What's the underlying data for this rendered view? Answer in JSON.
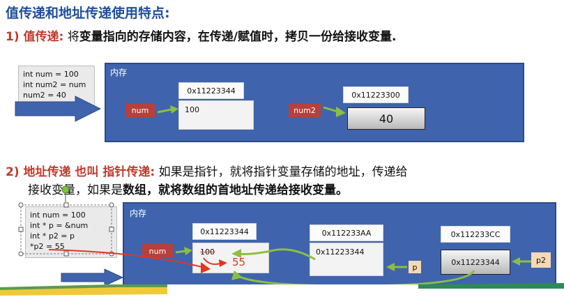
{
  "heading": "值传递和地址传递使用特点:",
  "section1": {
    "lead": "1) 值传递",
    "colon": ":",
    "text_a": "将",
    "text_b": "变量指向的存储内容，在传递/赋值时，拷贝一份给接收变量."
  },
  "section2": {
    "lead": "2) 地址传递 也叫 指针传递",
    "colon": ":",
    "text_a": "如果是指针，就将指针变量存储的地址，传递给",
    "text_b1": "接收变量，如果是",
    "text_b2": "数组，就将数组的首地址传递给接收变量。"
  },
  "diagram1": {
    "code": [
      "int num = 100",
      "int num2 = num",
      "num2 = 40"
    ],
    "memory_label": "内存",
    "addr1": "0x11223344",
    "var1": "num",
    "value1": "100",
    "addr2": "0x11223300",
    "var2": "num2",
    "value2": "40"
  },
  "diagram2": {
    "code": [
      "int num = 100",
      "int * p = &num",
      "int * p2 = p",
      "*p2 = 55"
    ],
    "memory_label": "内存",
    "addr1": "0x11223344",
    "var1": "num",
    "old_value": "100",
    "new_value": "55",
    "addr2": "0x112233AA",
    "cell2_value": "0x11223344",
    "var2": "p",
    "addr3": "0x112233CC",
    "cell3_value": "0x11223344",
    "var3": "p2"
  },
  "colors": {
    "heading": "#1f4e9a",
    "lead": "#c0392b",
    "memory_bg": "#3f64ad",
    "var_bg": "#b7403c",
    "arrow_green": "#8cbf3f",
    "arrow_blue": "#3f64ad",
    "arrow_red": "#e2361f"
  }
}
